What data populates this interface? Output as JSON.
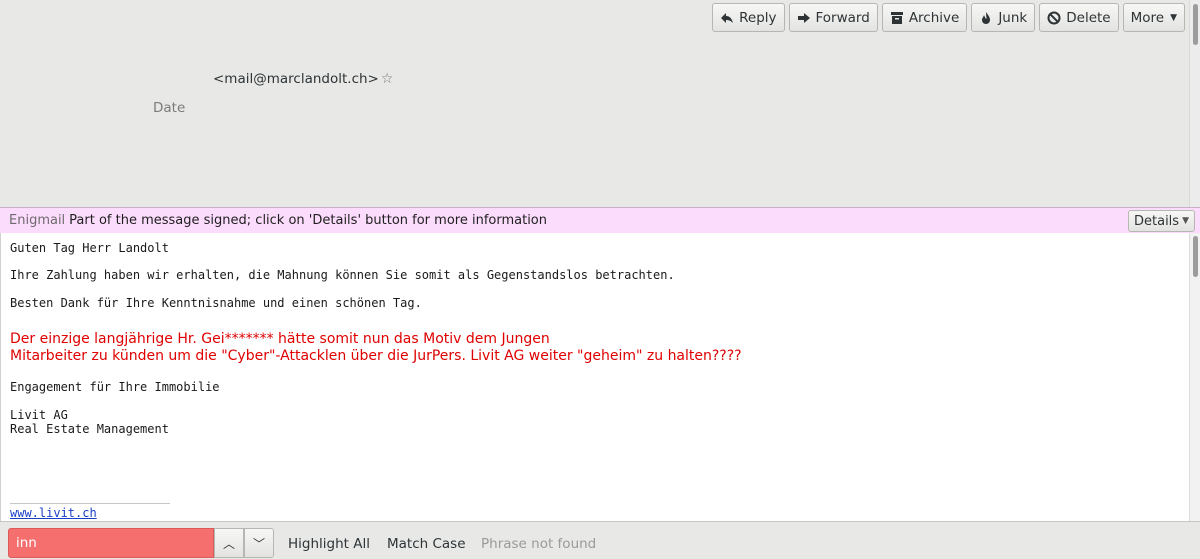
{
  "toolbar": {
    "reply_label": "Reply",
    "forward_label": "Forward",
    "archive_label": "Archive",
    "junk_label": "Junk",
    "delete_label": "Delete",
    "more_label": "More"
  },
  "header": {
    "from_address": "<mail@marclandolt.ch>",
    "star_icon": "☆",
    "date_label": "Date"
  },
  "enigmail": {
    "label": "Enigmail",
    "message": "Part of the message signed; click on 'Details' button for more information",
    "details_label": "Details"
  },
  "message": {
    "greeting": "Guten Tag Herr Landolt",
    "line1": "Ihre Zahlung haben wir erhalten, die Mahnung können Sie somit als Gegenstandslos betrachten.",
    "line2": "Besten Dank für Ihre Kenntnisnahme und einen schönen Tag.",
    "red_line1": "Der einzige langjährige Hr. Gei******* hätte somit nun das Motiv dem Jungen",
    "red_line2": "Mitarbeiter zu künden um die \"Cyber\"-Attacklen über die JurPers. Livit AG weiter \"geheim\" zu halten????",
    "engagement": "Engagement für Ihre Immobilie",
    "company": "Livit AG",
    "company_sub": "Real Estate Management",
    "website": "www.livit.ch"
  },
  "findbar": {
    "search_value": "inn",
    "highlight_all_label": "Highlight All",
    "match_case_label": "Match Case",
    "status": "Phrase not found"
  },
  "colors": {
    "enigmail_bg": "#fcdcfc",
    "find_error_bg": "#f66f6f",
    "red_text": "#e00000",
    "link": "#1a3fc7"
  }
}
